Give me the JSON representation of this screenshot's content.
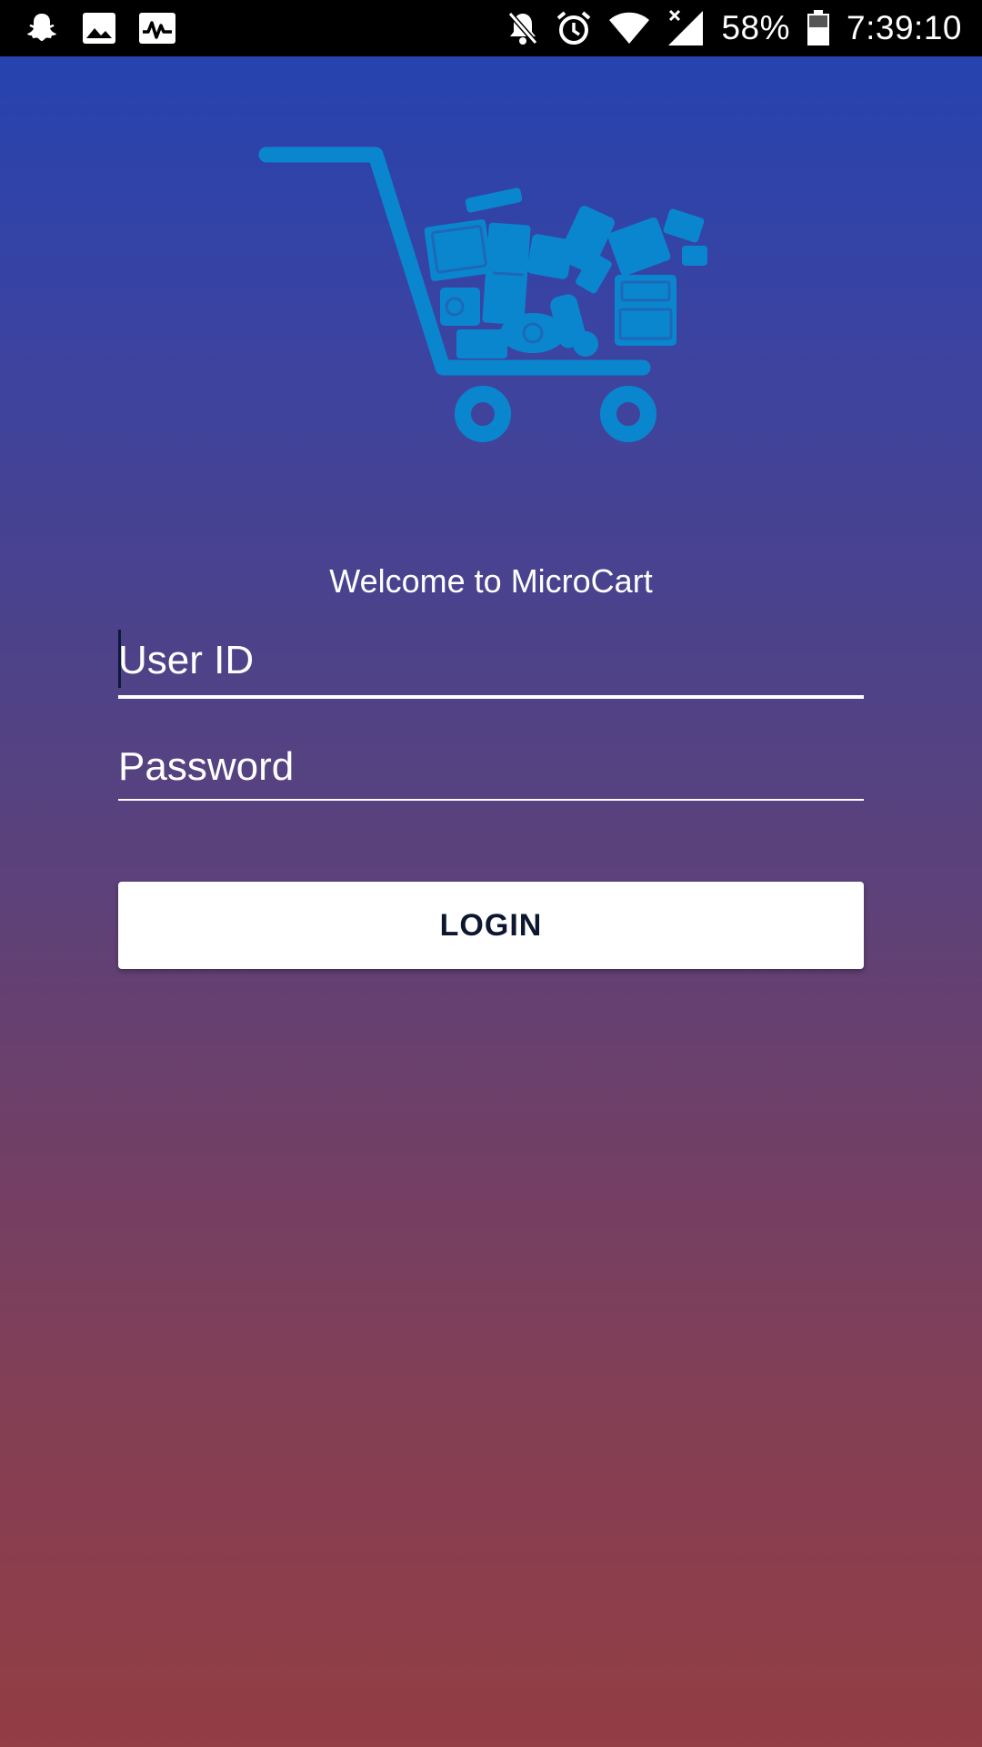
{
  "status_bar": {
    "left_icons": [
      "snapchat-icon",
      "gallery-icon",
      "activity-icon"
    ],
    "right_icons": [
      "notifications-off-icon",
      "alarm-icon",
      "wifi-icon",
      "signal-icon",
      "battery-icon"
    ],
    "battery_percent": "58%",
    "time": "7:39:10"
  },
  "logo": {
    "icon": "shopping-cart-logo-icon",
    "color": "#0a86cf"
  },
  "login": {
    "welcome_text": "Welcome to MicroCart",
    "user_id_value": "",
    "user_id_placeholder": "User ID",
    "password_value": "",
    "password_placeholder": "Password",
    "login_label": "LOGIN"
  },
  "colors": {
    "gradient_top": "#2243b2",
    "gradient_bottom": "#933d44",
    "button_bg": "#ffffff",
    "button_text": "#0d1730"
  }
}
